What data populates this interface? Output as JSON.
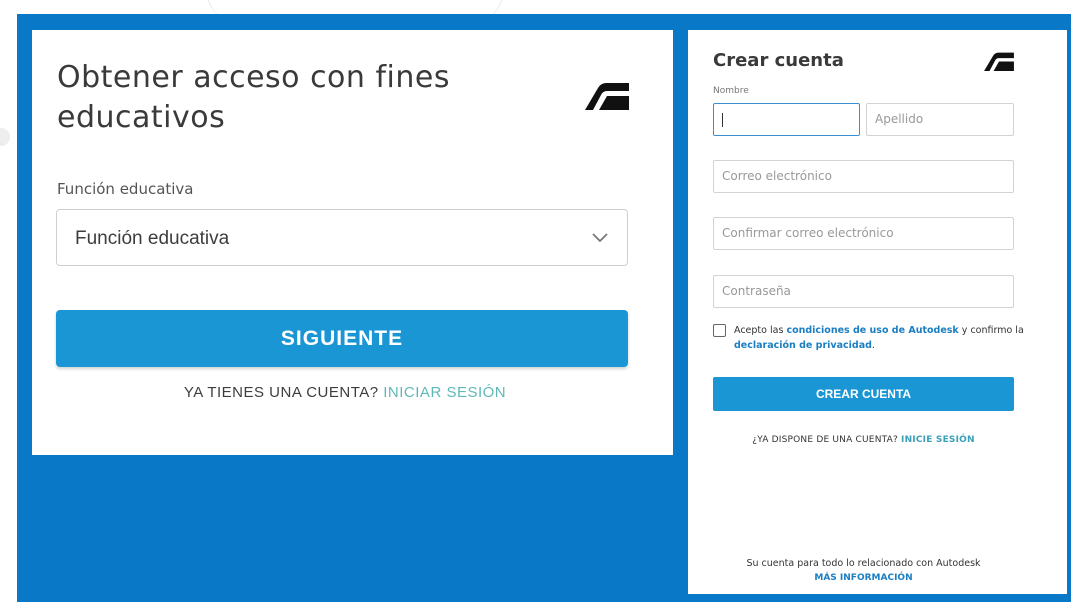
{
  "education_form": {
    "title": "Obtener acceso con fines educativos",
    "role_label": "Función educativa",
    "role_select_value": "Función educativa",
    "next_button": "SIGUIENTE",
    "have_account_text": "YA TIENES UNA CUENTA?",
    "signin_link": "INICIAR SESIÓN"
  },
  "create_account_form": {
    "title": "Crear cuenta",
    "first_name_label": "Nombre",
    "first_name_value": "",
    "last_name_placeholder": "Apellido",
    "email_placeholder": "Correo electrónico",
    "confirm_email_placeholder": "Confirmar correo electrónico",
    "password_placeholder": "Contraseña",
    "terms_prefix": "Acepto las",
    "terms_link": "condiciones de uso de Autodesk",
    "terms_middle": "y confirmo la",
    "privacy_link": "declaración de privacidad",
    "terms_suffix": ".",
    "terms_checked": false,
    "create_button": "CREAR CUENTA",
    "have_account_text": "¿YA DISPONE DE UNA CUENTA?",
    "signin_link": "INICIE SESIÓN",
    "footer_text": "Su cuenta para todo lo relacionado con Autodesk",
    "more_info_link": "MÁS INFORMACIÓN"
  },
  "icons": {
    "logo": "autodesk-logo-icon",
    "select_chevron": "chevron-down-icon"
  },
  "colors": {
    "page_blue": "#0978c6",
    "primary_button": "#1a96d5",
    "link_blue": "#1a7ec2",
    "signin_teal": "#5fb8b8"
  }
}
